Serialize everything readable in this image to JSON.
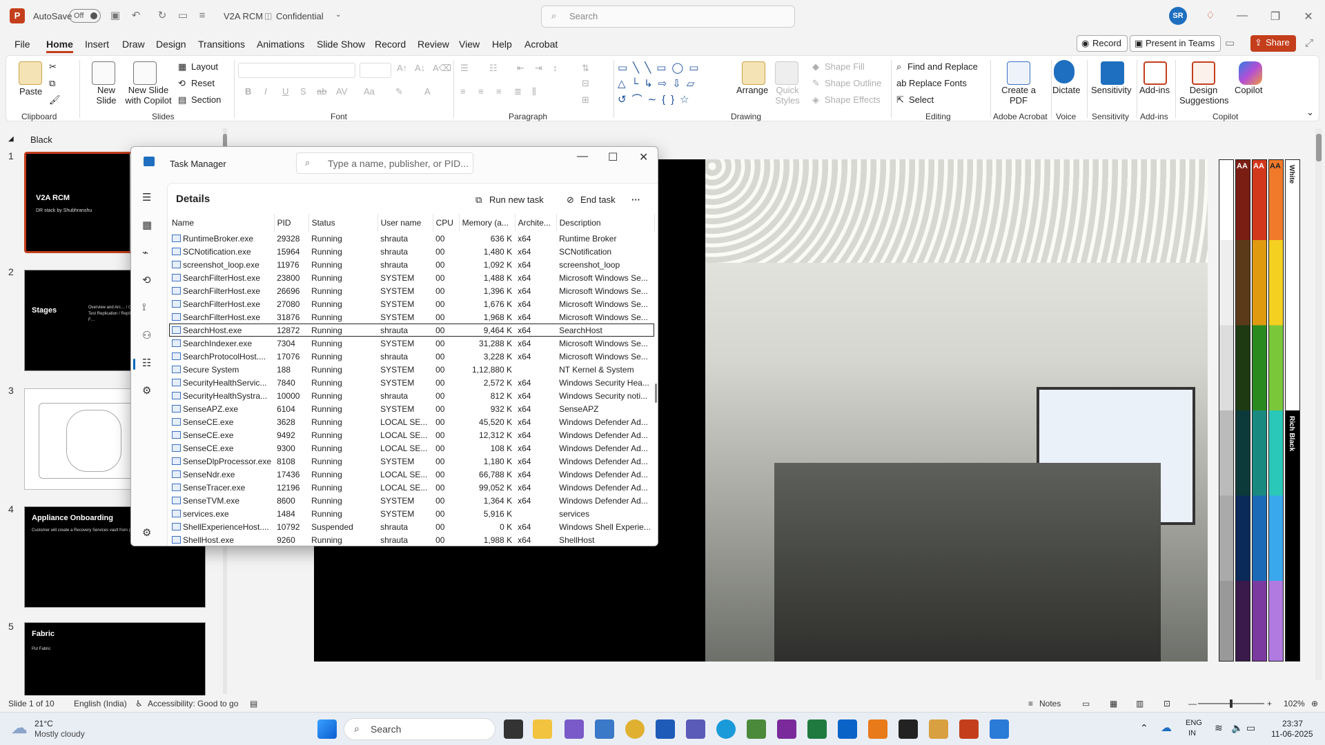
{
  "titlebar": {
    "autosave": "AutoSave",
    "toggle": "Off",
    "filename": "V2A RCM",
    "sensitivity": "Confidential",
    "search_placeholder": "Search",
    "user_initials": "SR"
  },
  "tabs": [
    "File",
    "Home",
    "Insert",
    "Draw",
    "Design",
    "Transitions",
    "Animations",
    "Slide Show",
    "Record",
    "Review",
    "View",
    "Help",
    "Acrobat"
  ],
  "top_buttons": {
    "record": "Record",
    "present": "Present in Teams",
    "share": "Share"
  },
  "ribbon": {
    "clipboard": {
      "paste": "Paste",
      "label": "Clipboard"
    },
    "slides": {
      "new_slide": "New Slide",
      "new_slide_copilot": "New Slide with Copilot",
      "layout": "Layout",
      "reset": "Reset",
      "section": "Section",
      "label": "Slides"
    },
    "font": {
      "label": "Font"
    },
    "paragraph": {
      "label": "Paragraph"
    },
    "drawing": {
      "arrange": "Arrange",
      "quick_styles": "Quick Styles",
      "shape_fill": "Shape Fill",
      "shape_outline": "Shape Outline",
      "shape_effects": "Shape Effects",
      "label": "Drawing"
    },
    "editing": {
      "find_replace": "Find and Replace",
      "replace_fonts": "Replace Fonts",
      "select": "Select",
      "label": "Editing"
    },
    "acrobat": {
      "create_pdf": "Create a PDF",
      "label": "Adobe Acrobat"
    },
    "voice": {
      "dictate": "Dictate",
      "label": "Voice"
    },
    "sensitivity": {
      "btn": "Sensitivity",
      "label": "Sensitivity"
    },
    "addins": {
      "btn": "Add-ins",
      "label": "Add-ins"
    },
    "copilot": {
      "design": "Design Suggestions",
      "copilot": "Copilot",
      "label": "Copilot"
    }
  },
  "slides_pane": {
    "section": "Black",
    "slides": [
      {
        "num": "1",
        "title": "V2A RCM",
        "sub": "DR stack by Shubhranshu"
      },
      {
        "num": "2",
        "title": "Stages",
        "sub": "Overview and Arc… / Onboarding / Enable Protection / Test Replication / Replication / Fail O… / Reprotection / F…"
      },
      {
        "num": "3",
        "title": "",
        "sub": ""
      },
      {
        "num": "4",
        "title": "Appliance Onboarding",
        "sub": "Customer will create a Recovery Services vault from portal in the target region"
      },
      {
        "num": "5",
        "title": "Fabric",
        "sub": "Put Fabric"
      }
    ]
  },
  "task_manager": {
    "title": "Task Manager",
    "search_placeholder": "Type a name, publisher, or PID...",
    "page_title": "Details",
    "run_new_task": "Run new task",
    "end_task": "End task",
    "columns": [
      "Name",
      "PID",
      "Status",
      "User name",
      "CPU",
      "Memory (a...",
      "Archite...",
      "Description"
    ],
    "rows": [
      [
        "RuntimeBroker.exe",
        "29328",
        "Running",
        "shrauta",
        "00",
        "636 K",
        "x64",
        "Runtime Broker"
      ],
      [
        "SCNotification.exe",
        "15964",
        "Running",
        "shrauta",
        "00",
        "1,480 K",
        "x64",
        "SCNotification"
      ],
      [
        "screenshot_loop.exe",
        "11976",
        "Running",
        "shrauta",
        "00",
        "1,092 K",
        "x64",
        "screenshot_loop"
      ],
      [
        "SearchFilterHost.exe",
        "23800",
        "Running",
        "SYSTEM",
        "00",
        "1,488 K",
        "x64",
        "Microsoft Windows Se..."
      ],
      [
        "SearchFilterHost.exe",
        "26696",
        "Running",
        "SYSTEM",
        "00",
        "1,396 K",
        "x64",
        "Microsoft Windows Se..."
      ],
      [
        "SearchFilterHost.exe",
        "27080",
        "Running",
        "SYSTEM",
        "00",
        "1,676 K",
        "x64",
        "Microsoft Windows Se..."
      ],
      [
        "SearchFilterHost.exe",
        "31876",
        "Running",
        "SYSTEM",
        "00",
        "1,968 K",
        "x64",
        "Microsoft Windows Se..."
      ],
      [
        "SearchHost.exe",
        "12872",
        "Running",
        "shrauta",
        "00",
        "9,464 K",
        "x64",
        "SearchHost"
      ],
      [
        "SearchIndexer.exe",
        "7304",
        "Running",
        "SYSTEM",
        "00",
        "31,288 K",
        "x64",
        "Microsoft Windows Se..."
      ],
      [
        "SearchProtocolHost....",
        "17076",
        "Running",
        "shrauta",
        "00",
        "3,228 K",
        "x64",
        "Microsoft Windows Se..."
      ],
      [
        "Secure System",
        "188",
        "Running",
        "SYSTEM",
        "00",
        "1,12,880 K",
        "",
        "NT Kernel & System"
      ],
      [
        "SecurityHealthServic...",
        "7840",
        "Running",
        "SYSTEM",
        "00",
        "2,572 K",
        "x64",
        "Windows Security Hea..."
      ],
      [
        "SecurityHealthSystra...",
        "10000",
        "Running",
        "shrauta",
        "00",
        "812 K",
        "x64",
        "Windows Security noti..."
      ],
      [
        "SenseAPZ.exe",
        "6104",
        "Running",
        "SYSTEM",
        "00",
        "932 K",
        "x64",
        "SenseAPZ"
      ],
      [
        "SenseCE.exe",
        "3628",
        "Running",
        "LOCAL SE...",
        "00",
        "45,520 K",
        "x64",
        "Windows Defender Ad..."
      ],
      [
        "SenseCE.exe",
        "9492",
        "Running",
        "LOCAL SE...",
        "00",
        "12,312 K",
        "x64",
        "Windows Defender Ad..."
      ],
      [
        "SenseCE.exe",
        "9300",
        "Running",
        "LOCAL SE...",
        "00",
        "108 K",
        "x64",
        "Windows Defender Ad..."
      ],
      [
        "SenseDlpProcessor.exe",
        "8108",
        "Running",
        "SYSTEM",
        "00",
        "1,180 K",
        "x64",
        "Windows Defender Ad..."
      ],
      [
        "SenseNdr.exe",
        "17436",
        "Running",
        "LOCAL SE...",
        "00",
        "66,788 K",
        "x64",
        "Windows Defender Ad..."
      ],
      [
        "SenseTracer.exe",
        "12196",
        "Running",
        "LOCAL SE...",
        "00",
        "99,052 K",
        "x64",
        "Windows Defender Ad..."
      ],
      [
        "SenseTVM.exe",
        "8600",
        "Running",
        "SYSTEM",
        "00",
        "1,364 K",
        "x64",
        "Windows Defender Ad..."
      ],
      [
        "services.exe",
        "1484",
        "Running",
        "SYSTEM",
        "00",
        "5,916 K",
        "",
        "services"
      ],
      [
        "ShellExperienceHost....",
        "10792",
        "Suspended",
        "shrauta",
        "00",
        "0 K",
        "x64",
        "Windows Shell Experie..."
      ],
      [
        "ShellHost.exe",
        "9260",
        "Running",
        "shrauta",
        "00",
        "1,988 K",
        "x64",
        "ShellHost"
      ]
    ]
  },
  "swatches": {
    "white": "White",
    "rich_black": "Rich Black",
    "aa": "AA"
  },
  "statusbar": {
    "slide": "Slide 1 of 10",
    "language": "English (India)",
    "accessibility": "Accessibility: Good to go",
    "notes": "Notes",
    "zoom": "102%"
  },
  "taskbar": {
    "temp": "21°C",
    "weather": "Mostly cloudy",
    "search": "Search",
    "lang1": "ENG",
    "lang2": "IN",
    "time": "23:37",
    "date": "11-06-2025"
  },
  "colors": {
    "accent": "#c43e1c",
    "blue": "#0067c0"
  }
}
